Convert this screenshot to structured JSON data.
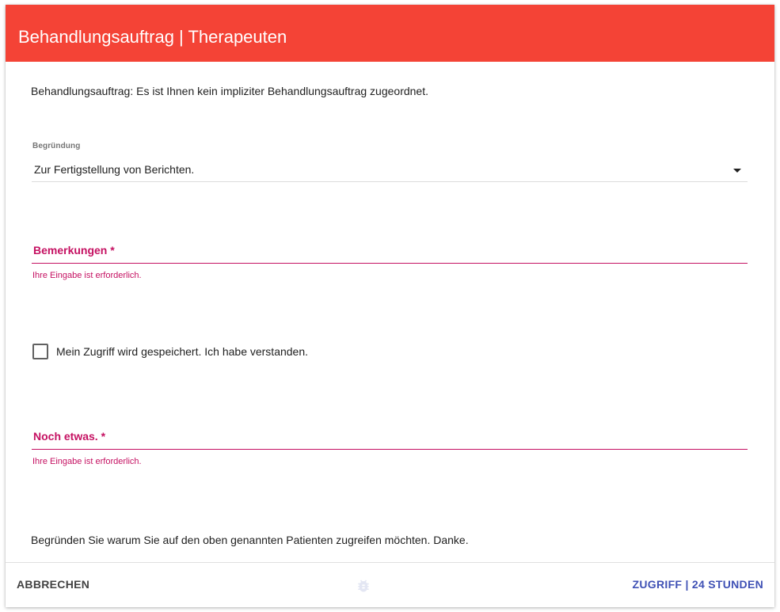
{
  "dialog": {
    "title": "Behandlungsauftrag | Therapeuten",
    "info_text": "Behandlungsauftrag: Es ist Ihnen kein impliziter Behandlungsauftrag zugeordnet.",
    "reason": {
      "label": "Begründung",
      "selected": "Zur Fertigstellung von Berichten."
    },
    "remarks": {
      "label": "Bemerkungen *",
      "value": "",
      "error": "Ihre Eingabe ist erforderlich."
    },
    "consent": {
      "label": "Mein Zugriff wird gespeichert. Ich habe verstanden.",
      "checked": false
    },
    "extra": {
      "label": "Noch etwas. *",
      "value": "",
      "error": "Ihre Eingabe ist erforderlich."
    },
    "hint": "Begründen Sie warum Sie auf den oben genannten Patienten zugreifen möchten. Danke.",
    "footer": {
      "cancel_label": "ABBRECHEN",
      "access_label": "ZUGRIFF | 24 STUNDEN",
      "bug_icon": "bug-icon"
    }
  },
  "colors": {
    "header": "#f44336",
    "error": "#c51162",
    "primary": "#3f51b5"
  }
}
